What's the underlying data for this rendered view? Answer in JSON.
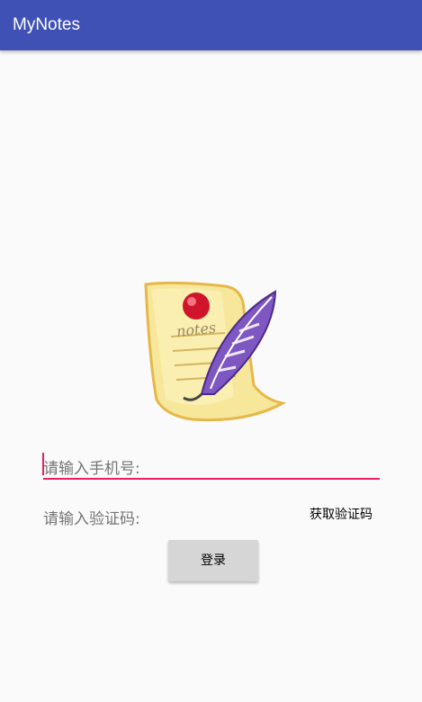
{
  "app": {
    "title": "MyNotes",
    "primary_color": "#3f51b5",
    "accent_color": "#e91e63"
  },
  "logo": {
    "icon": "notes-feather-icon",
    "text": "notes"
  },
  "form": {
    "phone_placeholder": "请输入手机号:",
    "code_placeholder": "请输入验证码:",
    "get_code_label": "获取验证码",
    "login_label": "登录"
  }
}
